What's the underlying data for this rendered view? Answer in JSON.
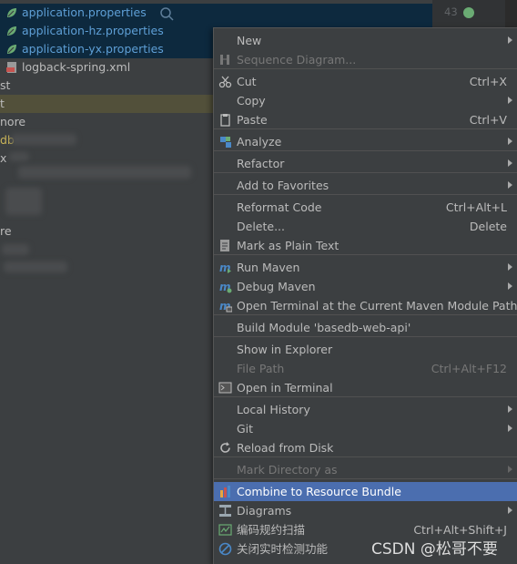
{
  "tree": {
    "files": [
      {
        "name": "application.properties",
        "icon": "spring-properties-icon"
      },
      {
        "name": "application-hz.properties",
        "icon": "spring-properties-icon"
      },
      {
        "name": "application-yx.properties",
        "icon": "spring-properties-icon"
      },
      {
        "name": "logback-spring.xml",
        "icon": "xml-file-icon"
      }
    ],
    "partial_items": [
      "st",
      "t",
      "nore",
      "db",
      "x",
      "",
      "re",
      "",
      ""
    ],
    "line_number": "43"
  },
  "menu": {
    "items": [
      {
        "label": "New",
        "shortcut": "",
        "submenu": true,
        "disabled": false,
        "icon": ""
      },
      {
        "label": "Sequence Diagram...",
        "shortcut": "",
        "submenu": false,
        "disabled": true,
        "icon": "sequence-diagram-icon"
      },
      {
        "label": "Cut",
        "shortcut": "Ctrl+X",
        "submenu": false,
        "disabled": false,
        "icon": "scissors-icon"
      },
      {
        "label": "Copy",
        "shortcut": "",
        "submenu": true,
        "disabled": false,
        "icon": ""
      },
      {
        "label": "Paste",
        "shortcut": "Ctrl+V",
        "submenu": false,
        "disabled": false,
        "icon": "clipboard-icon"
      },
      {
        "label": "Analyze",
        "shortcut": "",
        "submenu": true,
        "disabled": false,
        "icon": "analyze-icon"
      },
      {
        "label": "Refactor",
        "shortcut": "",
        "submenu": true,
        "disabled": false,
        "icon": ""
      },
      {
        "label": "Add to Favorites",
        "shortcut": "",
        "submenu": true,
        "disabled": false,
        "icon": ""
      },
      {
        "label": "Reformat Code",
        "shortcut": "Ctrl+Alt+L",
        "submenu": false,
        "disabled": false,
        "icon": ""
      },
      {
        "label": "Delete...",
        "shortcut": "Delete",
        "submenu": false,
        "disabled": false,
        "icon": ""
      },
      {
        "label": "Mark as Plain Text",
        "shortcut": "",
        "submenu": false,
        "disabled": false,
        "icon": "plain-text-icon"
      },
      {
        "label": "Run Maven",
        "shortcut": "",
        "submenu": true,
        "disabled": false,
        "icon": "maven-run-icon"
      },
      {
        "label": "Debug Maven",
        "shortcut": "",
        "submenu": true,
        "disabled": false,
        "icon": "maven-debug-icon"
      },
      {
        "label": "Open Terminal at the Current Maven Module Path",
        "shortcut": "",
        "submenu": false,
        "disabled": false,
        "icon": "maven-terminal-icon"
      },
      {
        "label": "Build Module 'basedb-web-api'",
        "shortcut": "",
        "submenu": false,
        "disabled": false,
        "icon": ""
      },
      {
        "label": "Show in Explorer",
        "shortcut": "",
        "submenu": false,
        "disabled": false,
        "icon": ""
      },
      {
        "label": "File Path",
        "shortcut": "Ctrl+Alt+F12",
        "submenu": false,
        "disabled": true,
        "icon": ""
      },
      {
        "label": "Open in Terminal",
        "shortcut": "",
        "submenu": false,
        "disabled": false,
        "icon": "terminal-icon"
      },
      {
        "label": "Local History",
        "shortcut": "",
        "submenu": true,
        "disabled": false,
        "icon": ""
      },
      {
        "label": "Git",
        "shortcut": "",
        "submenu": true,
        "disabled": false,
        "icon": ""
      },
      {
        "label": "Reload from Disk",
        "shortcut": "",
        "submenu": false,
        "disabled": false,
        "icon": "reload-icon"
      },
      {
        "label": "Mark Directory as",
        "shortcut": "",
        "submenu": true,
        "disabled": true,
        "icon": ""
      },
      {
        "label": "Combine to Resource Bundle",
        "shortcut": "",
        "submenu": false,
        "disabled": false,
        "active": true,
        "icon": "resource-bundle-icon"
      },
      {
        "label": "Diagrams",
        "shortcut": "",
        "submenu": true,
        "disabled": false,
        "icon": "diagrams-icon"
      },
      {
        "label": "编码规约扫描",
        "shortcut": "Ctrl+Alt+Shift+J",
        "submenu": false,
        "disabled": false,
        "icon": "code-scan-icon"
      },
      {
        "label": "关闭实时检测功能",
        "shortcut": "",
        "submenu": false,
        "disabled": false,
        "icon": "disable-detect-icon"
      }
    ]
  },
  "watermark": "CSDN @松哥不要",
  "colors": {
    "menu_bg": "#3c3f41",
    "active": "#4b6eaf",
    "selection": "#0d293e",
    "link": "#5e9fd6"
  }
}
